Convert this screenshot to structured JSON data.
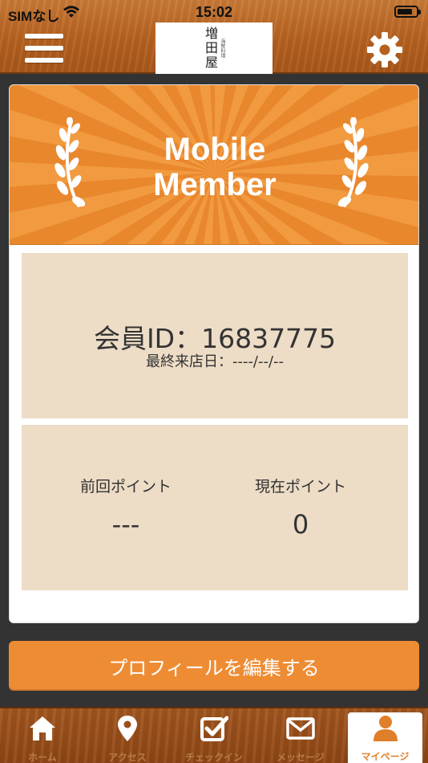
{
  "status_bar": {
    "carrier": "SIMなし",
    "time": "15:02"
  },
  "header": {
    "logo": {
      "name": "増田屋",
      "subtitle": "海鮮料理"
    },
    "menu_icon": "hamburger-icon",
    "settings_icon": "gear-icon"
  },
  "banner": {
    "title_line1": "Mobile",
    "title_line2": "Member"
  },
  "member": {
    "id_text": "会員ID：16837775",
    "last_visit": "最終来店日：----/--/--"
  },
  "points": {
    "previous_label": "前回ポイント",
    "previous_value": "---",
    "current_label": "現在ポイント",
    "current_value": "0"
  },
  "profile_button": {
    "label": "プロフィールを編集する"
  },
  "tabs": [
    {
      "label": "ホーム",
      "icon": "home-icon"
    },
    {
      "label": "アクセス",
      "icon": "map-pin-icon"
    },
    {
      "label": "チェックイン",
      "icon": "checkbox-icon"
    },
    {
      "label": "メッセージ",
      "icon": "envelope-icon"
    },
    {
      "label": "マイページ",
      "icon": "person-icon",
      "active": true
    }
  ],
  "colors": {
    "accent": "#ee8c34",
    "panel": "#eddcc6",
    "header_wood": "#b5611f",
    "active_tab_icon": "#e07f2a"
  }
}
